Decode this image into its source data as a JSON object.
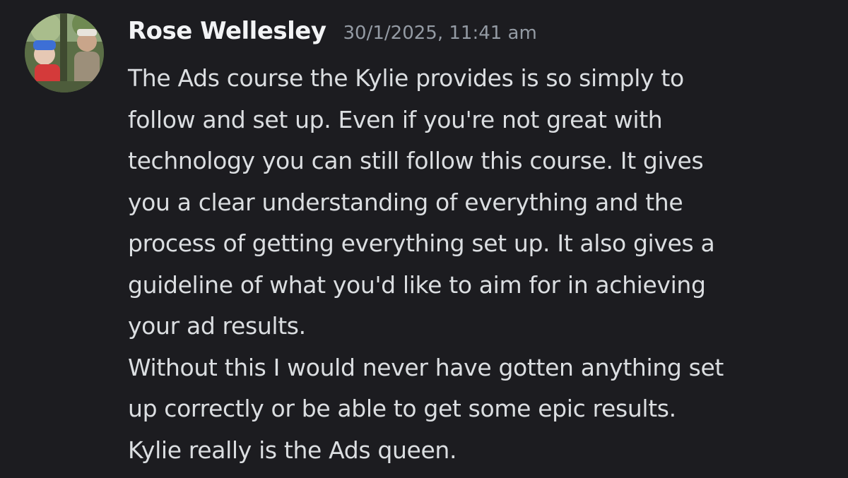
{
  "message": {
    "author": "Rose Wellesley",
    "timestamp": "30/1/2025, 11:41 am",
    "lines": [
      "The Ads course the Kylie provides is so simply to",
      "follow and set up. Even if you're not great with",
      "technology you can still follow this course. It gives",
      "you a clear understanding of everything and the",
      "process of getting everything set up. It also gives a",
      "guideline of what you'd like to aim for in achieving",
      "your ad results.",
      "Without this I would never have gotten anything set",
      "up correctly or be able to get some epic results.",
      "Kylie really is the Ads queen."
    ]
  },
  "colors": {
    "background": "#1c1c20",
    "username": "#f2f3f5",
    "timestamp": "#949ba4",
    "text": "#dbdee1"
  }
}
